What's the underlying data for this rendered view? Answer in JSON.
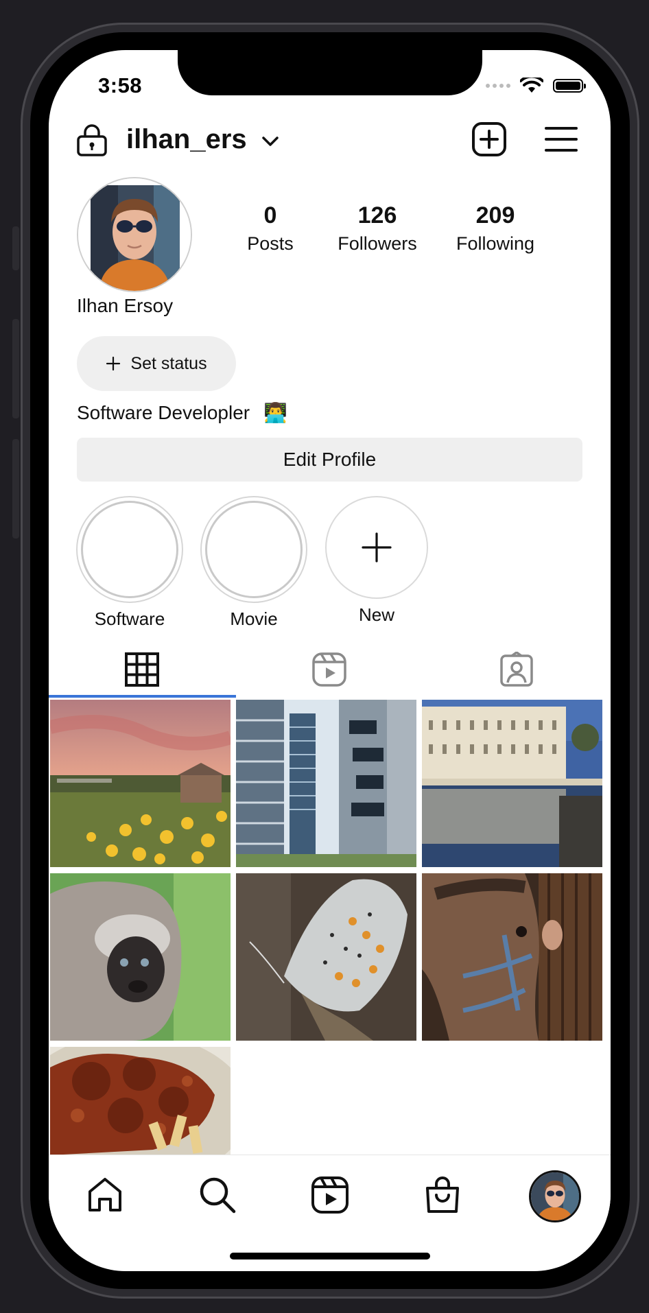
{
  "status_bar": {
    "time": "3:58"
  },
  "header": {
    "username": "ilhan_ers"
  },
  "profile": {
    "name": "Ilhan Ersoy",
    "posts": {
      "count": "0",
      "label": "Posts"
    },
    "followers": {
      "count": "126",
      "label": "Followers"
    },
    "following": {
      "count": "209",
      "label": "Following"
    },
    "set_status_label": "Set status",
    "bio": "Software Developler",
    "bio_emoji": "👨‍💻",
    "edit_profile_label": "Edit Profile"
  },
  "highlights": [
    {
      "label": "Software"
    },
    {
      "label": "Movie"
    },
    {
      "label": "New"
    }
  ],
  "tabs": [
    "grid-icon",
    "reels-icon",
    "tagged-icon"
  ],
  "posts": [
    "sunset-field-photo",
    "skyscrapers-photo",
    "building-reflection-photo",
    "monkey-photo",
    "butterfly-photo",
    "horse-photo",
    "pasta-photo"
  ],
  "bottom_nav": [
    "home-icon",
    "search-icon",
    "reels-icon",
    "shop-icon",
    "profile-avatar"
  ],
  "colors": {
    "accent": "#3a75d8",
    "button_bg": "#efefef"
  }
}
